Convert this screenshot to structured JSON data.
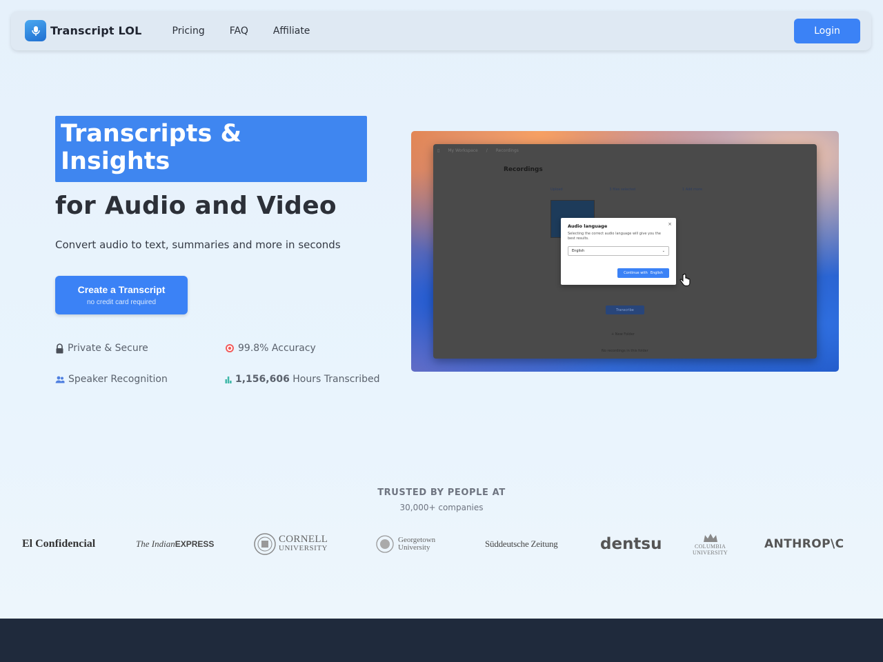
{
  "nav": {
    "brand": "Transcript LOL",
    "links": [
      "Pricing",
      "FAQ",
      "Affiliate"
    ],
    "login_label": "Login"
  },
  "hero": {
    "highlight_line1": "Transcripts &",
    "highlight_line2": "Insights",
    "subtitle": "for Audio and Video",
    "description": "Convert audio to text, summaries and more in seconds",
    "cta_label": "Create a Transcript",
    "cta_sublabel": "no credit card required",
    "features": {
      "private": "Private & Secure",
      "accuracy": "99.8% Accuracy",
      "speaker": "Speaker Recognition",
      "hours_count": "1,156,606",
      "hours_label": "Hours Transcribed"
    }
  },
  "preview": {
    "breadcrumb": [
      "My Workspace",
      "/",
      "Recordings"
    ],
    "page_title": "Recordings",
    "tabs": [
      "Upload",
      "3 files selected",
      "1 Add more"
    ],
    "transcribe_label": "Transcribe",
    "new_folder_label": "+ New Folder",
    "empty_label": "No recordings in this folder",
    "modal": {
      "title": "Audio language",
      "description": "Selecting the correct audio language will give you the best results.",
      "selected_language": "English",
      "continue_label": "Continue with",
      "continue_lang": "English"
    }
  },
  "trusted": {
    "title": "TRUSTED BY PEOPLE AT",
    "subtitle": "30,000+ companies",
    "logos": {
      "elconfidencial": "El Confidencial",
      "indian_italic": "The Indian",
      "indian_bold": "EXPRESS",
      "cornell_line1": "CORNELL",
      "cornell_line2": "UNIVERSITY",
      "georgetown_line1": "Georgetown",
      "georgetown_line2": "University",
      "sz": "Süddeutsche Zeitung",
      "dentsu": "dentsu",
      "columbia_line1": "COLUMBIA",
      "columbia_line2": "UNIVERSITY",
      "anthropic": "ANTHROP\\C"
    }
  },
  "colors": {
    "accent": "#3b82f6",
    "footer": "#1f2a3c",
    "background": "#e6f1fb"
  },
  "icons": [
    "microphone-logo-icon",
    "lock-icon",
    "target-icon",
    "people-icon",
    "bar-chart-icon",
    "cursor-hand-icon"
  ]
}
